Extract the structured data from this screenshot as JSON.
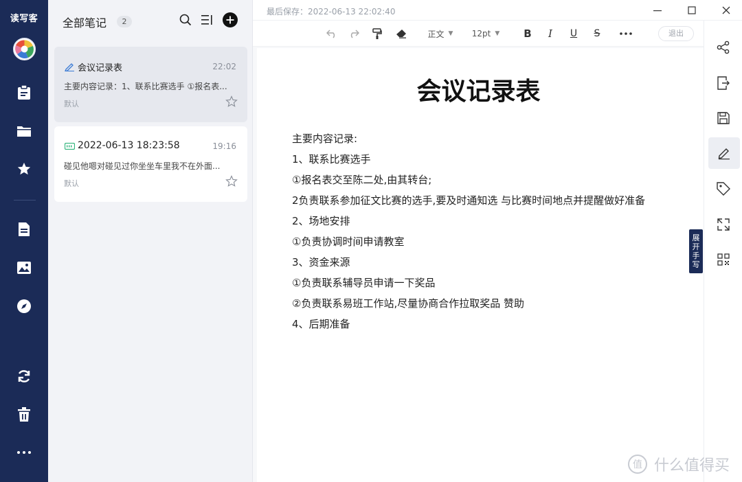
{
  "app": {
    "brand": "读写客"
  },
  "list": {
    "title": "全部笔记",
    "count": "2",
    "notes": [
      {
        "title": "会议记录表",
        "time": "22:02",
        "excerpt": "主要内容记录：1、联系比赛选手 ①报名表...",
        "tag": "默认"
      },
      {
        "title": "2022-06-13 18:23:58",
        "time": "19:16",
        "excerpt": "碰见他嗯对碰见过你坐坐车里我不在外面...",
        "tag": "默认"
      }
    ]
  },
  "editor": {
    "saved": "最后保存：2022-06-13 22:02:40",
    "toolbar": {
      "style": "正文",
      "size": "12pt",
      "exit": "退出"
    },
    "title": "会议记录表",
    "lines": [
      "主要内容记录:",
      "1、联系比赛选手",
      "①报名表交至陈二处,由其转台;",
      "2负责联系参加征文比赛的选手,要及时通知选 与比赛时间地点并提醒做好准备",
      "2、场地安排",
      "①负责协调时间申请教室",
      "3、资金来源",
      "①负责联系辅导员申请一下奖品",
      "②负责联系易班工作站,尽量协商合作拉取奖品 赞助",
      "4、后期准备"
    ],
    "handwrite": "展开手写"
  },
  "watermark": {
    "symbol": "值",
    "text": "什么值得买"
  },
  "colors": {
    "rail": "#1b2b57",
    "panel": "#f2f3f7",
    "accent_green": "#2fb37a",
    "accent_blue": "#3a7bd5"
  }
}
